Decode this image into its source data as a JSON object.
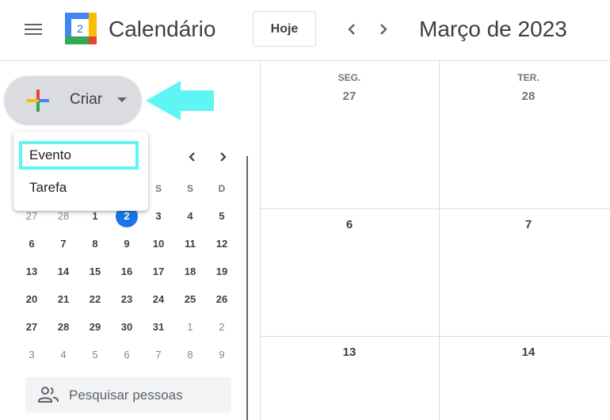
{
  "header": {
    "app_title": "Calendário",
    "logo_day": "2",
    "today_button": "Hoje",
    "month_title": "Março de 2023"
  },
  "sidebar": {
    "create_button": "Criar",
    "create_menu": {
      "items": [
        "Evento",
        "Tarefa"
      ],
      "highlighted_item": "Evento"
    },
    "mini_calendar": {
      "visible_weekday_headers": [
        "S",
        "S",
        "D"
      ],
      "weeks": [
        [
          "27",
          "28",
          "1",
          "2",
          "3",
          "4",
          "5"
        ],
        [
          "6",
          "7",
          "8",
          "9",
          "10",
          "11",
          "12"
        ],
        [
          "13",
          "14",
          "15",
          "16",
          "17",
          "18",
          "19"
        ],
        [
          "20",
          "21",
          "22",
          "23",
          "24",
          "25",
          "26"
        ],
        [
          "27",
          "28",
          "29",
          "30",
          "31",
          "1",
          "2"
        ],
        [
          "3",
          "4",
          "5",
          "6",
          "7",
          "8",
          "9"
        ]
      ],
      "today": "2"
    },
    "people_search": {
      "placeholder": "Pesquisar pessoas"
    }
  },
  "main": {
    "columns": [
      {
        "day_name": "SEG.",
        "date": "27"
      },
      {
        "day_name": "TER.",
        "date": "28"
      }
    ],
    "rows": [
      [
        "6",
        "7"
      ],
      [
        "13",
        "14"
      ]
    ]
  },
  "colors": {
    "accent": "#1a73e8",
    "highlight": "#5ff5f5",
    "create_button_bg": "#dadce0",
    "border": "#dadce0"
  }
}
